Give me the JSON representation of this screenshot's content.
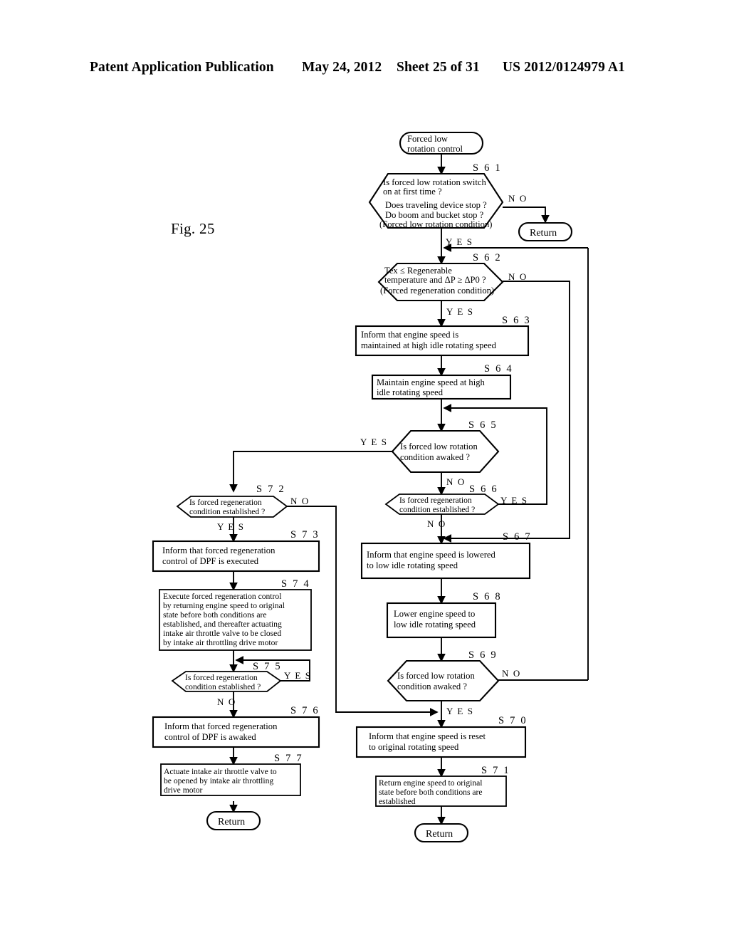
{
  "header": {
    "publication": "Patent Application Publication",
    "date": "May 24, 2012",
    "sheet": "Sheet 25 of 31",
    "number": "US 2012/0124979 A1"
  },
  "figure": {
    "label": "Fig. 25",
    "title": "Forced low rotation control flowchart"
  },
  "chart_data": {
    "type": "diagram",
    "diagram_kind": "flowchart",
    "title": "Forced low rotation control",
    "nodes": [
      {
        "id": "start",
        "kind": "terminator",
        "step": "",
        "lines": [
          "Forced low",
          "rotation control"
        ]
      },
      {
        "id": "S61",
        "kind": "decision",
        "step": "S 6 1",
        "lines": [
          "Is forced low rotation switch",
          "on at first time ?",
          "Does traveling device stop ?",
          "Do boom and bucket stop ?",
          "(Forced low rotation condition)"
        ]
      },
      {
        "id": "ret61",
        "kind": "terminator",
        "step": "",
        "lines": [
          "Return"
        ]
      },
      {
        "id": "S62",
        "kind": "decision",
        "step": "S 6 2",
        "lines": [
          "Tex ≤ Regenerable",
          "temperature and ΔP ≥ ΔP0 ?",
          "(Forced regeneration condition)"
        ]
      },
      {
        "id": "S63",
        "kind": "process",
        "step": "S 6 3",
        "lines": [
          "Inform that engine speed is",
          "maintained at high idle rotating speed"
        ]
      },
      {
        "id": "S64",
        "kind": "process",
        "step": "S 6 4",
        "lines": [
          "Maintain engine speed at high",
          "idle rotating speed"
        ]
      },
      {
        "id": "S65",
        "kind": "decision",
        "step": "S 6 5",
        "lines": [
          "Is forced low rotation",
          "condition awaked ?"
        ]
      },
      {
        "id": "S66",
        "kind": "decision",
        "step": "S 6 6",
        "lines": [
          "Is forced regeneration",
          "condition established ?"
        ]
      },
      {
        "id": "S67",
        "kind": "process",
        "step": "S 6 7",
        "lines": [
          "Inform that engine speed is lowered",
          "to low idle rotating speed"
        ]
      },
      {
        "id": "S68",
        "kind": "process",
        "step": "S 6 8",
        "lines": [
          "Lower engine speed to",
          "low idle rotating speed"
        ]
      },
      {
        "id": "S69",
        "kind": "decision",
        "step": "S 6 9",
        "lines": [
          "Is forced low rotation",
          "condition awaked ?"
        ]
      },
      {
        "id": "S70",
        "kind": "process",
        "step": "S 7 0",
        "lines": [
          "Inform that engine speed is reset",
          "to original rotating speed"
        ]
      },
      {
        "id": "S71",
        "kind": "process",
        "step": "S 7 1",
        "lines": [
          "Return engine speed to original",
          "state before both conditions are",
          "established"
        ]
      },
      {
        "id": "ret71",
        "kind": "terminator",
        "step": "",
        "lines": [
          "Return"
        ]
      },
      {
        "id": "S72",
        "kind": "decision",
        "step": "S 7 2",
        "lines": [
          "Is forced regeneration",
          "condition established ?"
        ]
      },
      {
        "id": "S73",
        "kind": "process",
        "step": "S 7 3",
        "lines": [
          "Inform that forced regeneration",
          "control of DPF is executed"
        ]
      },
      {
        "id": "S74",
        "kind": "process",
        "step": "S 7 4",
        "lines": [
          "Execute forced regeneration control",
          "by returning engine speed to original",
          "state before both conditions are",
          "established, and thereafter actuating",
          "intake air throttle valve to be closed",
          "by intake air throttling drive motor"
        ]
      },
      {
        "id": "S75",
        "kind": "decision",
        "step": "S 7 5",
        "lines": [
          "Is forced regeneration",
          "condition established ?"
        ]
      },
      {
        "id": "S76",
        "kind": "process",
        "step": "S 7 6",
        "lines": [
          "Inform that forced regeneration",
          "control of DPF is awaked"
        ]
      },
      {
        "id": "S77",
        "kind": "process",
        "step": "S 7 7",
        "lines": [
          "Actuate intake air throttle valve to",
          "be opened by intake air throttling",
          "drive motor"
        ]
      },
      {
        "id": "ret77",
        "kind": "terminator",
        "step": "",
        "lines": [
          "Return"
        ]
      }
    ],
    "edges": [
      {
        "from": "start",
        "to": "S61",
        "label": ""
      },
      {
        "from": "S61",
        "to": "ret61",
        "label": "N O"
      },
      {
        "from": "S61",
        "to": "S62",
        "label": "Y E S"
      },
      {
        "from": "S62",
        "to": "S67",
        "label": "N O"
      },
      {
        "from": "S62",
        "to": "S63",
        "label": "Y E S"
      },
      {
        "from": "S63",
        "to": "S64",
        "label": ""
      },
      {
        "from": "S64",
        "to": "S65",
        "label": ""
      },
      {
        "from": "S65",
        "to": "S72",
        "label": "Y E S"
      },
      {
        "from": "S65",
        "to": "S66",
        "label": "N O"
      },
      {
        "from": "S66",
        "to": "S65",
        "label": "Y E S"
      },
      {
        "from": "S66",
        "to": "S67",
        "label": "N O"
      },
      {
        "from": "S67",
        "to": "S68",
        "label": ""
      },
      {
        "from": "S68",
        "to": "S69",
        "label": ""
      },
      {
        "from": "S69",
        "to": "S62",
        "label": "N O"
      },
      {
        "from": "S69",
        "to": "S70",
        "label": "Y E S"
      },
      {
        "from": "S70",
        "to": "S71",
        "label": ""
      },
      {
        "from": "S71",
        "to": "ret71",
        "label": ""
      },
      {
        "from": "S72",
        "to": "S70",
        "label": "N O"
      },
      {
        "from": "S72",
        "to": "S73",
        "label": "Y E S"
      },
      {
        "from": "S73",
        "to": "S74",
        "label": ""
      },
      {
        "from": "S74",
        "to": "S75",
        "label": ""
      },
      {
        "from": "S75",
        "to": "S75",
        "label": "Y E S"
      },
      {
        "from": "S75",
        "to": "S76",
        "label": "N O"
      },
      {
        "from": "S76",
        "to": "S77",
        "label": ""
      },
      {
        "from": "S77",
        "to": "ret77",
        "label": ""
      }
    ],
    "branch_labels": {
      "s61_no": "N O",
      "s61_yes": "Y E S",
      "s62_no": "N O",
      "s62_yes": "Y E S",
      "s65_yes": "Y E S",
      "s65_no": "N O",
      "s66_yes": "Y E S",
      "s66_no": "N O",
      "s69_no": "N O",
      "s69_yes": "Y E S",
      "s72_no": "N O",
      "s72_yes": "Y E S",
      "s75_yes": "Y E S",
      "s75_no": "N O"
    }
  }
}
